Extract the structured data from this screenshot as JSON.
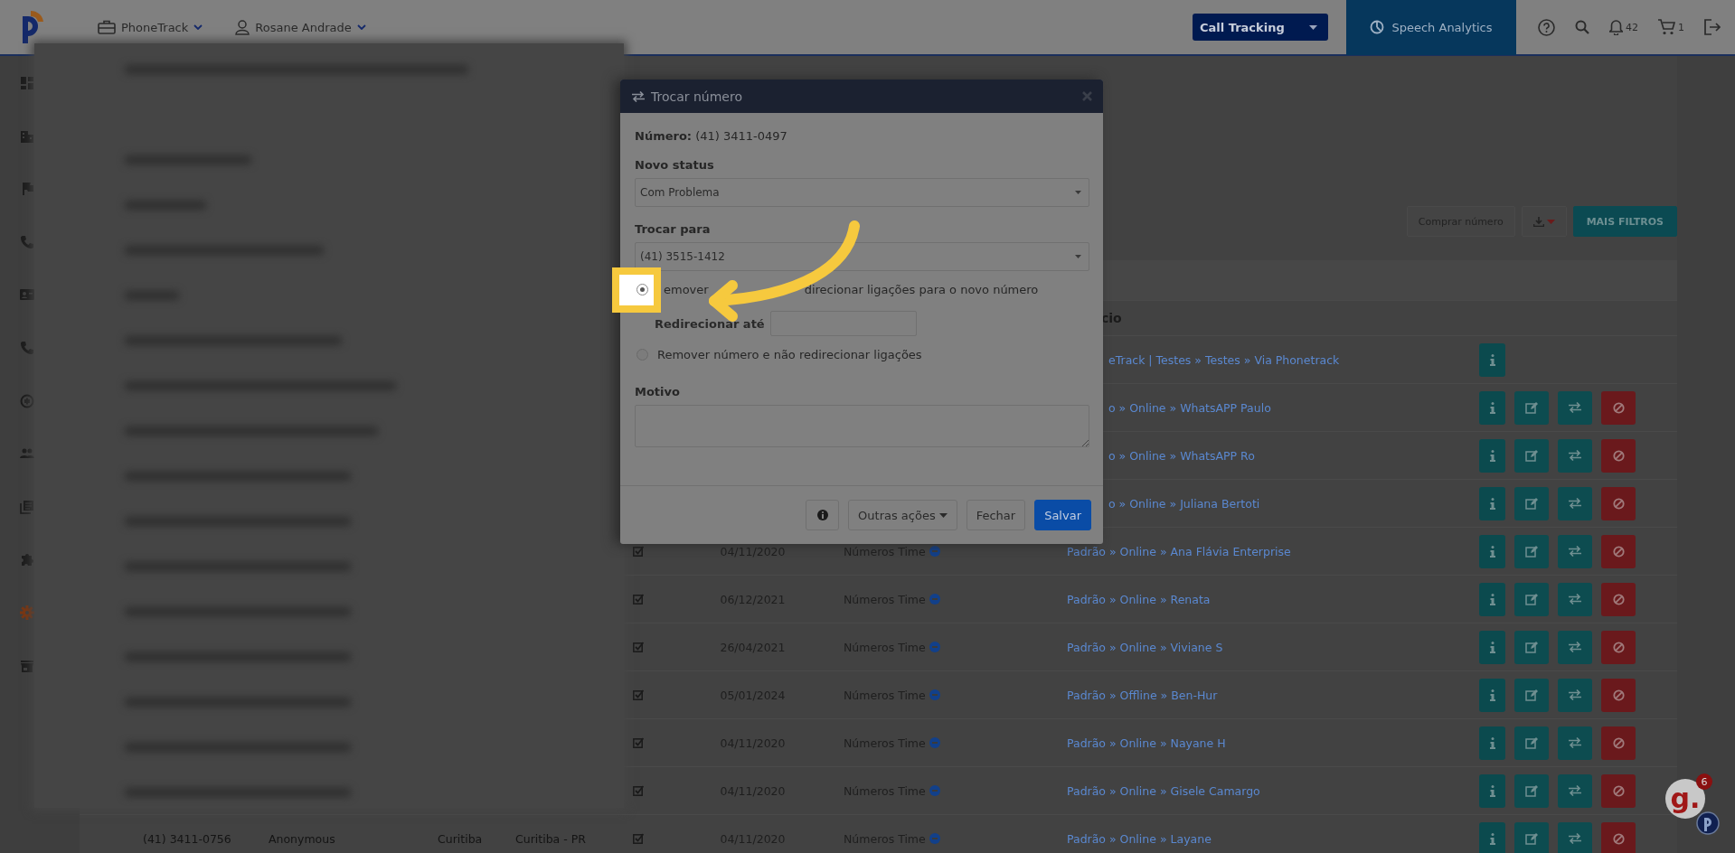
{
  "topbar": {
    "product": "PhoneTrack",
    "user": "Rosane Andrade",
    "module_select": "Call Tracking",
    "speech_tab": "Speech Analytics",
    "notifications": "42",
    "cart": "1"
  },
  "sidebar": {
    "items": [
      {
        "selected": false
      },
      {
        "selected": false
      },
      {
        "selected": false
      },
      {
        "selected": false
      },
      {
        "selected": false
      },
      {
        "selected": false
      },
      {
        "selected": false
      },
      {
        "selected": false
      },
      {
        "selected": false
      },
      {
        "selected": false
      },
      {
        "selected": true
      },
      {
        "selected": false
      }
    ]
  },
  "toolbar": {
    "buttons": [
      {
        "kind": "text",
        "label": "Comprar número"
      },
      {
        "kind": "download"
      },
      {
        "kind": "primary",
        "label": "MAIS FILTROS"
      }
    ]
  },
  "table": {
    "header_partial": "cio",
    "partly_covered_rows": [
      {
        "service": "eTrack | Testes » Testes » Via Phonetrack",
        "actions": [
          {
            "kind": "info"
          }
        ]
      },
      {
        "service": "o » Online » WhatsAPP Paulo",
        "actions": [
          {
            "kind": "info"
          },
          {
            "kind": "edit"
          },
          {
            "kind": "swap"
          },
          {
            "kind": "block"
          }
        ]
      },
      {
        "service": "o » Online » WhatsAPP Ro",
        "actions": [
          {
            "kind": "info"
          },
          {
            "kind": "edit"
          },
          {
            "kind": "swap"
          },
          {
            "kind": "block"
          }
        ]
      },
      {
        "service": "o » Online » Juliana Bertoti",
        "actions": [
          {
            "kind": "info"
          },
          {
            "kind": "edit"
          },
          {
            "kind": "swap"
          },
          {
            "kind": "block"
          }
        ]
      }
    ],
    "rows": [
      {
        "checked": true,
        "date": "04/11/2020",
        "team": "Números Time",
        "service": "Padrão » Online » Ana Flávia Enterprise",
        "actions": [
          {
            "kind": "info"
          },
          {
            "kind": "edit"
          },
          {
            "kind": "swap"
          },
          {
            "kind": "block"
          }
        ]
      },
      {
        "checked": true,
        "date": "06/12/2021",
        "team": "Números Time",
        "service": "Padrão » Online » Renata",
        "actions": [
          {
            "kind": "info"
          },
          {
            "kind": "edit"
          },
          {
            "kind": "swap"
          },
          {
            "kind": "block"
          }
        ]
      },
      {
        "checked": true,
        "date": "26/04/2021",
        "team": "Números Time",
        "service": "Padrão » Online » Viviane S",
        "actions": [
          {
            "kind": "info"
          },
          {
            "kind": "edit"
          },
          {
            "kind": "swap"
          },
          {
            "kind": "block"
          }
        ]
      },
      {
        "checked": true,
        "date": "05/01/2024",
        "team": "Números Time",
        "service": "Padrão » Offline » Ben-Hur",
        "actions": [
          {
            "kind": "info"
          },
          {
            "kind": "edit"
          },
          {
            "kind": "swap"
          },
          {
            "kind": "block"
          }
        ]
      },
      {
        "checked": true,
        "date": "04/11/2020",
        "team": "Números Time",
        "service": "Padrão » Online » Nayane H",
        "actions": [
          {
            "kind": "info"
          },
          {
            "kind": "edit"
          },
          {
            "kind": "swap"
          },
          {
            "kind": "block"
          }
        ]
      },
      {
        "checked": true,
        "date": "04/11/2020",
        "team": "Números Time",
        "service": "Padrão » Online » Gisele Camargo",
        "actions": [
          {
            "kind": "info"
          },
          {
            "kind": "edit"
          },
          {
            "kind": "swap"
          },
          {
            "kind": "block"
          }
        ]
      },
      {
        "number": "(41) 3411-0756",
        "name": "Anonymous",
        "city": "Curitiba",
        "region": "Curitiba - PR",
        "checked": true,
        "date": "04/11/2020",
        "team": "Números Time",
        "service": "Padrão » Online » Layane",
        "actions": [
          {
            "kind": "info"
          },
          {
            "kind": "edit"
          },
          {
            "kind": "swap"
          },
          {
            "kind": "block"
          }
        ]
      }
    ]
  },
  "modal": {
    "title": "Trocar número",
    "number_label": "Número:",
    "number": "(41) 3411-0497",
    "status_label": "Novo status",
    "status_value": "Com Problema",
    "swap_label": "Trocar para",
    "swap_value": "(41) 3515-1412",
    "options": [
      {
        "label_parts": [
          "emover",
          "direcionar ligações para o novo número"
        ],
        "selected": true
      },
      {
        "label_parts": [
          "Remover número e não redirecionar ligações"
        ],
        "selected": false
      }
    ],
    "redirect_label": "Redirecionar até",
    "reason_label": "Motivo",
    "buttons": [
      {
        "kind": "info"
      },
      {
        "kind": "dropdown",
        "label": "Outras ações"
      },
      {
        "kind": "default",
        "label": "Fechar"
      },
      {
        "kind": "primary",
        "label": "Salvar"
      }
    ]
  },
  "chat_widget": {
    "label": "g.",
    "badge": "6"
  }
}
